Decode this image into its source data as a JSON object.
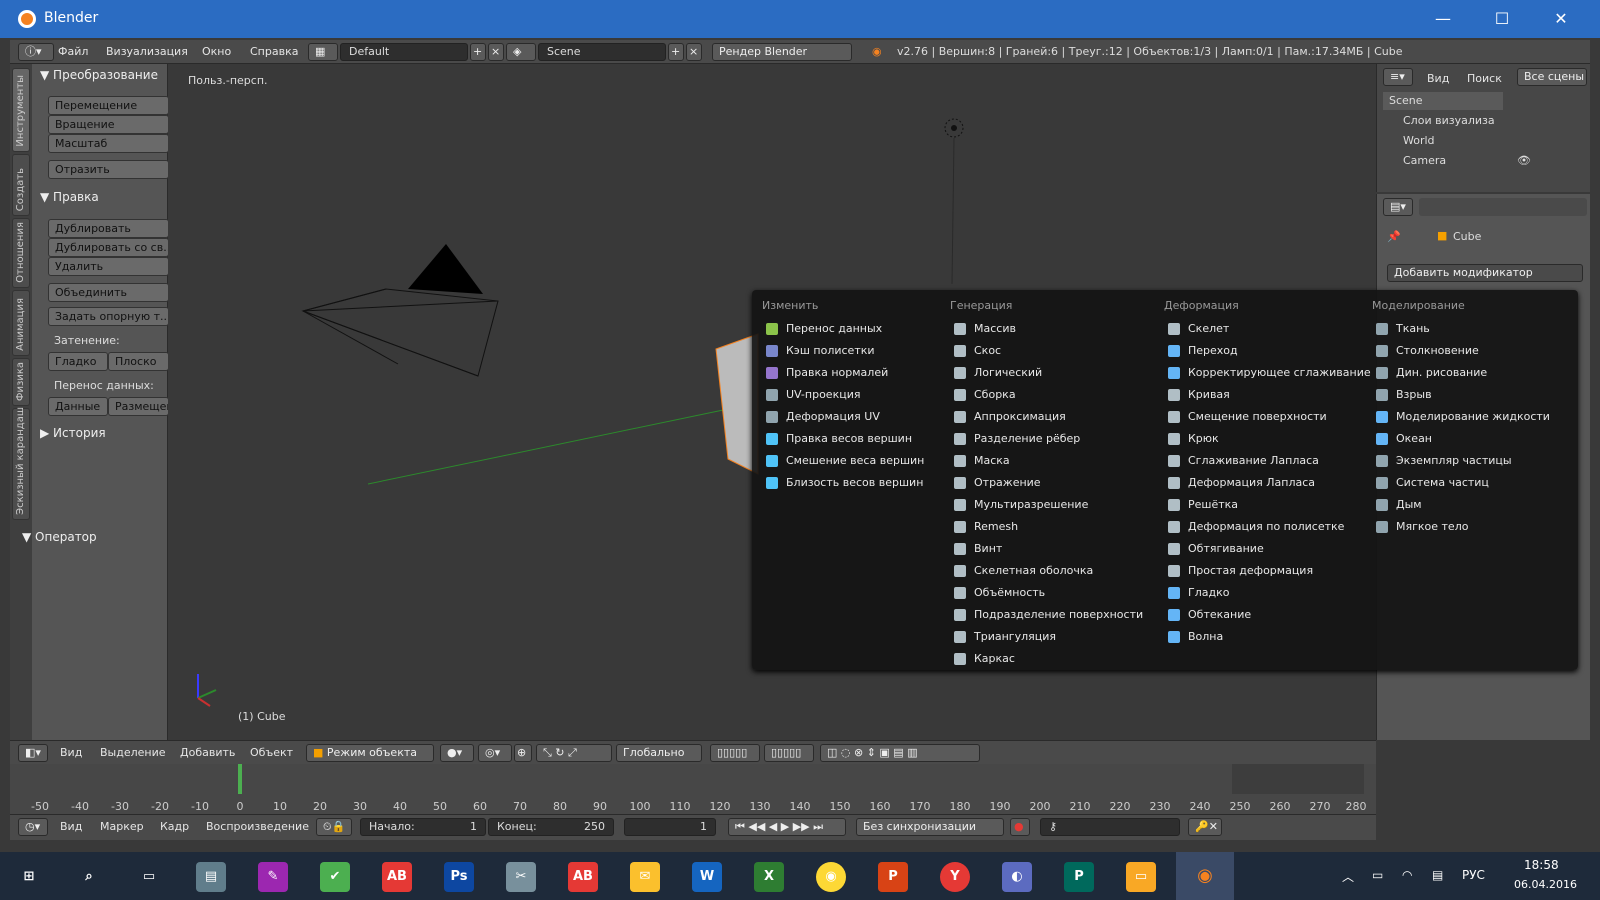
{
  "window": {
    "title": "Blender",
    "minimize": "—",
    "maximize": "☐",
    "close": "✕"
  },
  "topbar": {
    "menus": [
      "Файл",
      "Визуализация",
      "Окно",
      "Справка"
    ],
    "layout": "Default",
    "scene": "Scene",
    "engine": "Рендер Blender",
    "stats": "v2.76 | Вершин:8 | Граней:6 | Треуг.:12 | Объектов:1/3 | Ламп:0/1 | Пам.:17.34МБ | Cube"
  },
  "toolshelf": {
    "tabs": [
      "Инструменты",
      "Создать",
      "Отношения",
      "Анимация",
      "Физика",
      "Эскизный карандаш"
    ],
    "transform_header": "Преобразование",
    "transform": [
      "Перемещение",
      "Вращение",
      "Масштаб"
    ],
    "mirror": "Отразить",
    "edit_header": "Правка",
    "edit": [
      "Дублировать",
      "Дублировать со св...",
      "Удалить"
    ],
    "join": "Объединить",
    "set_origin": "Задать опорную т...",
    "shading_label": "Затенение:",
    "smooth": "Гладко",
    "flat": "Плоско",
    "datatransfer_label": "Перенос данных:",
    "data": "Данные",
    "layout": "Размещен",
    "history_header": "История",
    "operator_header": "Оператор"
  },
  "viewport": {
    "view_label": "Польз.-персп.",
    "object_label": "(1) Cube"
  },
  "addmenu": {
    "columns": [
      {
        "title": "Изменить",
        "items": [
          "Перенос данных",
          "Кэш полисетки",
          "Правка нормалей",
          "UV-проекция",
          "Деформация UV",
          "Правка весов вершин",
          "Смешение веса вершин",
          "Близость весов вершин"
        ]
      },
      {
        "title": "Генерация",
        "items": [
          "Массив",
          "Скос",
          "Логический",
          "Сборка",
          "Аппроксимация",
          "Разделение рёбер",
          "Маска",
          "Отражение",
          "Мультиразрешение",
          "Remesh",
          "Винт",
          "Скелетная оболочка",
          "Объёмность",
          "Подразделение поверхности",
          "Триангуляция",
          "Каркас"
        ]
      },
      {
        "title": "Деформация",
        "items": [
          "Скелет",
          "Переход",
          "Корректирующее сглаживание",
          "Кривая",
          "Смещение поверхности",
          "Крюк",
          "Сглаживание Лапласа",
          "Деформация Лапласа",
          "Решётка",
          "Деформация по полисетке",
          "Обтягивание",
          "Простая деформация",
          "Гладко",
          "Обтекание",
          "Волна"
        ]
      },
      {
        "title": "Моделирование",
        "items": [
          "Ткань",
          "Столкновение",
          "Дин. рисование",
          "Взрыв",
          "Моделирование жидкости",
          "Океан",
          "Экземпляр частицы",
          "Система частиц",
          "Дым",
          "Мягкое тело"
        ]
      }
    ]
  },
  "outliner": {
    "view": "Вид",
    "search": "Поиск",
    "all_scenes": "Все сцены",
    "rows": [
      "Scene",
      "Слои визуализа",
      "World",
      "Camera"
    ]
  },
  "props": {
    "object": "Cube",
    "add_modifier": "Добавить модификатор"
  },
  "vpheader": {
    "menus": [
      "Вид",
      "Выделение",
      "Добавить",
      "Объект"
    ],
    "mode": "Режим объекта",
    "orientation": "Глобально"
  },
  "timeline": {
    "ticks": [
      "-50",
      "-40",
      "-30",
      "-20",
      "-10",
      "0",
      "10",
      "20",
      "30",
      "40",
      "50",
      "60",
      "70",
      "80",
      "90",
      "100",
      "110",
      "120",
      "130",
      "140",
      "150",
      "160",
      "170",
      "180",
      "190",
      "200",
      "210",
      "220",
      "230",
      "240",
      "250",
      "260",
      "270",
      "280"
    ],
    "current_frame": "1"
  },
  "tlheader": {
    "menus": [
      "Вид",
      "Маркер",
      "Кадр",
      "Воспроизведение"
    ],
    "start": "Начало:",
    "start_val": "1",
    "end": "Конец:",
    "end_val": "250",
    "sync": "Без синхронизации"
  },
  "taskbar": {
    "lang": "РУС",
    "time": "18:58",
    "date": "06.04.2016"
  },
  "colors": {
    "accent": "#2b6cc2",
    "menu_bg": "#141414"
  }
}
